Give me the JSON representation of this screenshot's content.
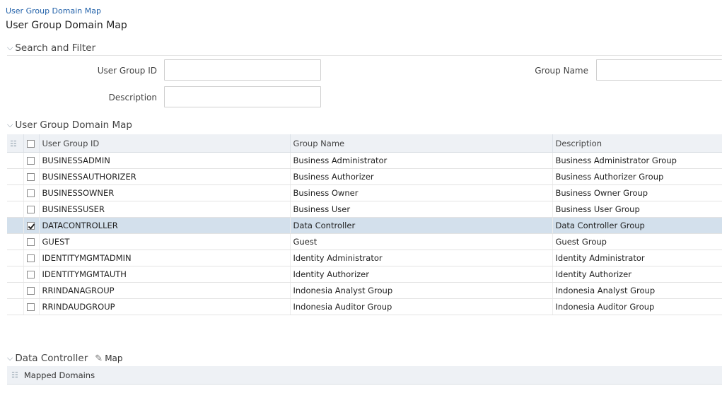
{
  "breadcrumb": "User Group Domain Map",
  "page_title": "User Group Domain Map",
  "search": {
    "header": "Search and Filter",
    "user_group_id_label": "User Group ID",
    "group_name_label": "Group Name",
    "description_label": "Description",
    "user_group_id_value": "",
    "group_name_value": "",
    "description_value": ""
  },
  "grid": {
    "header": "User Group Domain Map",
    "columns": [
      "User Group ID",
      "Group Name",
      "Description"
    ],
    "rows": [
      {
        "id": "BUSINESSADMIN",
        "name": "Business Administrator",
        "desc": "Business Administrator Group",
        "checked": false
      },
      {
        "id": "BUSINESSAUTHORIZER",
        "name": "Business Authorizer",
        "desc": "Business Authorizer Group",
        "checked": false
      },
      {
        "id": "BUSINESSOWNER",
        "name": "Business Owner",
        "desc": "Business Owner Group",
        "checked": false
      },
      {
        "id": "BUSINESSUSER",
        "name": "Business User",
        "desc": "Business User Group",
        "checked": false
      },
      {
        "id": "DATACONTROLLER",
        "name": "Data Controller",
        "desc": "Data Controller Group",
        "checked": true
      },
      {
        "id": "GUEST",
        "name": "Guest",
        "desc": "Guest Group",
        "checked": false
      },
      {
        "id": "IDENTITYMGMTADMIN",
        "name": "Identity Administrator",
        "desc": "Identity Administrator",
        "checked": false
      },
      {
        "id": "IDENTITYMGMTAUTH",
        "name": "Identity Authorizer",
        "desc": "Identity Authorizer",
        "checked": false
      },
      {
        "id": "RRINDANAGROUP",
        "name": "Indonesia Analyst Group",
        "desc": "Indonesia Analyst Group",
        "checked": false
      },
      {
        "id": "RRINDAUDGROUP",
        "name": "Indonesia Auditor Group",
        "desc": "Indonesia Auditor Group",
        "checked": false
      }
    ]
  },
  "detail": {
    "header": "Data Controller",
    "map_label": "Map",
    "mapped_domains_label": "Mapped Domains"
  },
  "icons": {
    "collapse": "chevron-down-icon",
    "tree": "hierarchy-icon",
    "edit": "pencil-icon"
  },
  "colors": {
    "breadcrumb_link": "#1f5fa8",
    "header_bg": "#eef1f5",
    "selected_row_bg": "#d3e0ec"
  }
}
